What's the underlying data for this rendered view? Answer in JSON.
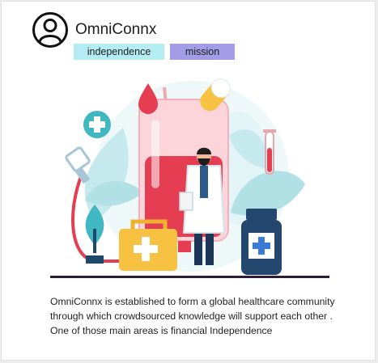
{
  "app": {
    "title": "OmniConnx"
  },
  "tags": [
    {
      "label": "independence",
      "color": "#b3ecf3"
    },
    {
      "label": "mission",
      "color": "#a49ce6"
    }
  ],
  "icons": {
    "avatar": "user-circle-icon"
  },
  "description": "OmniConnx is established to form a global healthcare community through which crowdsourced knowledge will support each other . One of those main areas is financial Independence",
  "colors": {
    "accent_red": "#e53e52",
    "accent_teal": "#7fd3d6",
    "accent_navy": "#24476f",
    "accent_yellow": "#f7c242"
  }
}
